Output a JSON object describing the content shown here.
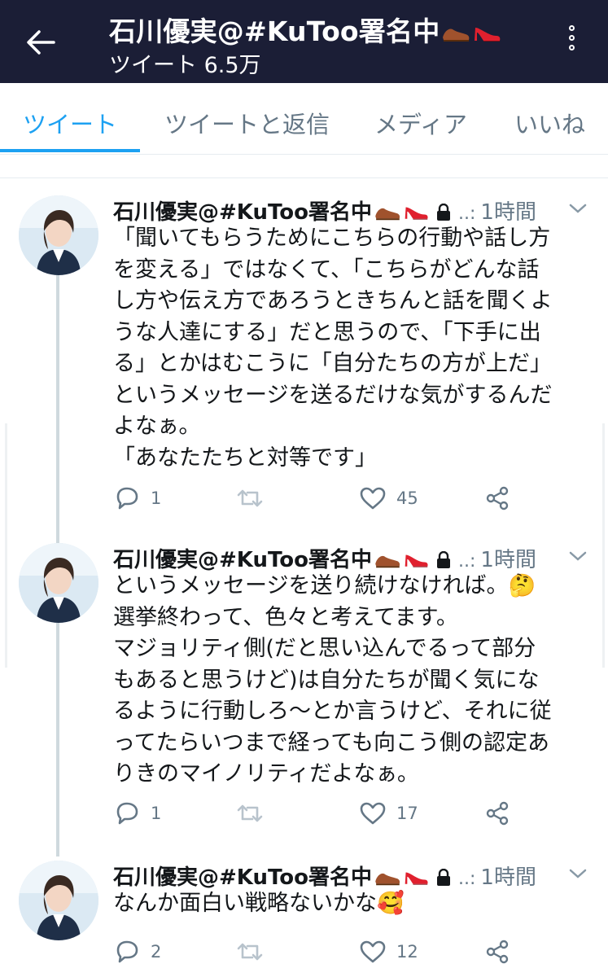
{
  "header": {
    "title": "石川優実@#KuToo署名中",
    "subtitle": "ツイート 6.5万",
    "back_icon": "arrow-left-icon",
    "menu_icon": "more-vertical-icon"
  },
  "tabs": [
    {
      "label": "ツイート",
      "active": true
    },
    {
      "label": "ツイートと返信",
      "active": false
    },
    {
      "label": "メディア",
      "active": false
    },
    {
      "label": "いいね",
      "active": false
    }
  ],
  "colors": {
    "topbar": "#1b1e36",
    "accent": "#1da1f2",
    "muted": "#657786",
    "thread_line": "#cfd9de"
  },
  "tweets": [
    {
      "author": "石川優実@#KuToo署名中",
      "handle": "..:",
      "time": "1時間",
      "lines": [
        "「聞いてもらうためにこちらの行動や話し方",
        "を変える」ではなくて、「こちらがどんな話",
        "し方や伝え方であろうときちんと話を聞くよ",
        "うな人達にする」だと思うので、「下手に出",
        "る」とかはむこうに「自分たちの方が上だ」",
        "というメッセージを送るだけな気がするんだ",
        "よなぁ。",
        "「あなたたちと対等です」"
      ],
      "replies": "1",
      "retweets": "",
      "likes": "45"
    },
    {
      "author": "石川優実@#KuToo署名中",
      "handle": "..:",
      "time": "1時間",
      "lines": [
        "というメッセージを送り続けなければ。🤔",
        "選挙終わって、色々と考えてます。",
        "マジョリティ側(だと思い込んでるって部分",
        "もあると思うけど)は自分たちが聞く気にな",
        "るように行動しろ〜とか言うけど、それに従",
        "ってたらいつまで経っても向こう側の認定あ",
        "りきのマイノリティだよなぁ。"
      ],
      "replies": "1",
      "retweets": "",
      "likes": "17"
    },
    {
      "author": "石川優実@#KuToo署名中",
      "handle": "..:",
      "time": "1時間",
      "lines": [
        "なんか面白い戦略ないかな🥰"
      ],
      "replies": "2",
      "retweets": "",
      "likes": "12"
    }
  ]
}
